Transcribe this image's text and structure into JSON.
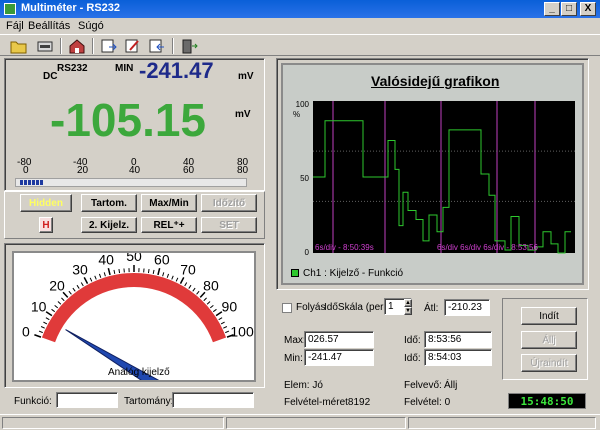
{
  "window": {
    "title": "Multiméter - RS232",
    "min_glyph": "_",
    "max_glyph": "□",
    "close_glyph": "X"
  },
  "menu": {
    "items": [
      "Fájl",
      "Beállítás",
      "Súgó"
    ]
  },
  "meter": {
    "port": "RS232",
    "mode": "DC",
    "min_label": "MIN",
    "min_value": "-241.47",
    "min_unit": "mV",
    "main_value": "-105.15",
    "main_unit": "mV",
    "scale_top": [
      "-80",
      "-40",
      "0",
      "40",
      "80"
    ],
    "scale_bottom": [
      "0",
      "20",
      "40",
      "60",
      "80"
    ],
    "bar_segments": 6
  },
  "buttons": {
    "hold": "Hidden",
    "range": "Tartom.",
    "maxmin": "Max/Min",
    "timer": "Időzítő",
    "h": "H",
    "second_display": "2. Kijelz.",
    "rel": "REL⁺+",
    "set": "SET"
  },
  "gauge": {
    "ticks": [
      "0",
      "10",
      "20",
      "30",
      "40",
      "50",
      "60",
      "70",
      "80",
      "90",
      "100"
    ],
    "label": "Analóg kijelző",
    "needle_value": 8
  },
  "bottom_fields": {
    "function_label": "Funkció:",
    "function_value": "",
    "range_label": "Tartomány:",
    "range_value": ""
  },
  "chart_data": {
    "type": "line",
    "title": "Valósidejű grafikon",
    "ylabel": "%",
    "yticks": [
      "100",
      "50",
      "0"
    ],
    "ylim": [
      0,
      100
    ],
    "x_annotations": [
      "6s/div - 8:50:39s",
      "6s/div 6s/div 6s/div - 8:53:56"
    ],
    "legend": "Ch1 : Kijelző - Funkció",
    "series": [
      {
        "color": "#2ec82e",
        "x": [
          0,
          12,
          12,
          50,
          50,
          75,
          75,
          82,
          82,
          86,
          86,
          90,
          90,
          95,
          95,
          103,
          103,
          110,
          110,
          116,
          116,
          124,
          124,
          130,
          130,
          136,
          136,
          168,
          168,
          176,
          176,
          182,
          182,
          192,
          192,
          198,
          198,
          206,
          206,
          215,
          215,
          223,
          223,
          230,
          230,
          238,
          238,
          245,
          245,
          252,
          252,
          258
        ],
        "y": [
          50,
          50,
          87,
          87,
          50,
          50,
          74,
          74,
          55,
          55,
          18,
          18,
          40,
          40,
          28,
          28,
          22,
          22,
          8,
          8,
          25,
          25,
          14,
          14,
          30,
          30,
          81,
          81,
          52,
          52,
          38,
          38,
          8,
          8,
          2,
          2,
          24,
          24,
          5,
          5,
          2,
          2,
          4,
          4,
          14,
          14,
          6,
          6,
          0,
          0,
          14,
          14
        ]
      }
    ]
  },
  "controls": {
    "folyas_label": "Folyás",
    "idoskala_label": "IdőSkála (perc)",
    "spinner_value": "1",
    "atl_label": "Átl:",
    "atl_value": "-210.23",
    "max_label": "Max:",
    "max_value": "026.57",
    "min_label": "Min:",
    "min_value": "-241.47",
    "ido_label": "Idő:",
    "ido_max": "8:53:56",
    "ido_min": "8:54:03",
    "start": "Indít",
    "stop": "Állj",
    "reset": "Újraindít"
  },
  "status": {
    "elem": "Elem: Jó",
    "felvevo": "Felvevő:",
    "felvevo_value": "Állj",
    "felvetel_meret": "Felvétel-méret8192",
    "felvetel": "Felvétel: 0",
    "clock": "15:48:50"
  }
}
